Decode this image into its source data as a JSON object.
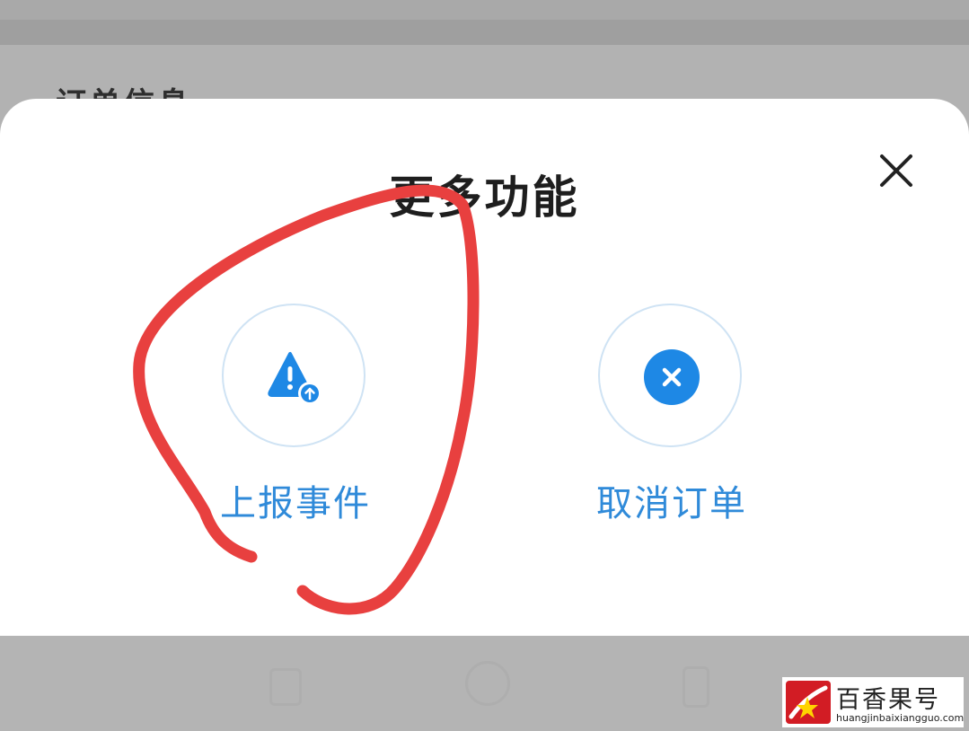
{
  "background": {
    "section_title": "订单信息"
  },
  "sheet": {
    "title": "更多功能",
    "close_icon": "close-icon",
    "actions": [
      {
        "label": "上报事件",
        "icon": "warning-upload-icon"
      },
      {
        "label": "取消订单",
        "icon": "cancel-circle-icon"
      }
    ]
  },
  "watermark": {
    "name": "百香果号",
    "url": "huangjinbaixiangguo.com"
  },
  "colors": {
    "accent_blue": "#2f8ad9",
    "icon_blue": "#1e88e5",
    "annotation_red": "#e8403f",
    "overlay_gray": "#b2b2b2"
  }
}
